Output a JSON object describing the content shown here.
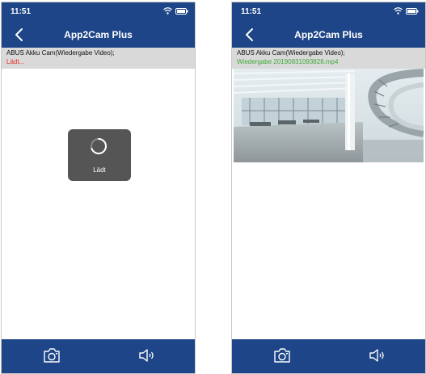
{
  "left_screen": {
    "status_time": "11:51",
    "nav_title": "App2Cam Plus",
    "info_line1": "ABUS Akku Cam(Wiedergabe Video);",
    "info_line2": "Lädt...",
    "loading_label": "Lädt",
    "icons": [
      "wifi-icon",
      "battery-icon",
      "back-arrow-icon",
      "spinner-icon",
      "snapshot-camera-icon",
      "speaker-icon"
    ]
  },
  "right_screen": {
    "status_time": "11:51",
    "nav_title": "App2Cam Plus",
    "info_line1": "ABUS Akku Cam(Wiedergabe Video);",
    "info_line2": "Wiedergabe 20190831093828.mp4",
    "icons": [
      "wifi-icon",
      "battery-icon",
      "back-arrow-icon",
      "snapshot-camera-icon",
      "speaker-icon"
    ]
  },
  "colors": {
    "brand_blue": "#1d4587",
    "info_bar_gray": "#d9d9d9",
    "loading_red": "#e8302a",
    "playback_green": "#3faa3c",
    "overlay_gray": "#555555"
  }
}
